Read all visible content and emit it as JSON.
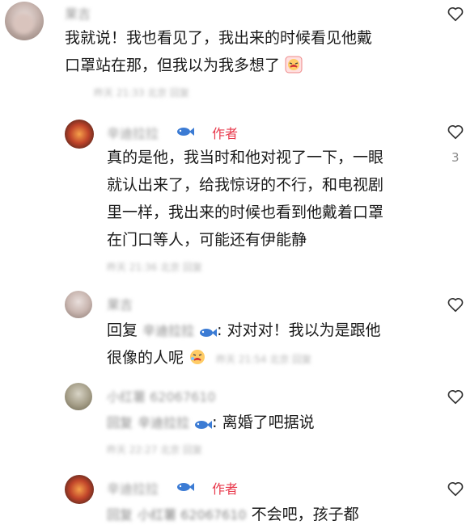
{
  "comments": [
    {
      "name": "果吉",
      "text_lines": [
        "我就说！我也看见了，我出来的时候看见他戴",
        "口罩站在那，但我以为我多想了"
      ],
      "meta": "昨天 21:33 北京 回复"
    },
    {
      "name": "辛迪拉拉",
      "author_tag": "作者",
      "text_lines": [
        "真的是他，我当时和他对视了一下，一眼",
        "就认出来了，给我惊讶的不行，和电视剧",
        "里一样，我出来的时候也看到他戴着口罩",
        "在门口等人，可能还有伊能静"
      ],
      "meta": "昨天 21:36 北京 回复",
      "like_count": "3"
    },
    {
      "name": "果吉",
      "reply_prefix": "回复",
      "reply_target": "辛迪拉拉",
      "text_part1": ": 对对对！我以为是跟他",
      "text_part2": "很像的人呢",
      "meta": "昨天 21:54 北京 回复"
    },
    {
      "name": "小红薯",
      "name_suffix": "62067610",
      "reply_prefix": "回复",
      "reply_target": "辛迪拉拉",
      "text": ": 离婚了吧据说",
      "meta": "昨天 22:27 北京 回复"
    },
    {
      "name": "辛迪拉拉",
      "author_tag": "作者",
      "reply_prefix": "回复",
      "reply_target": "小红薯 62067610",
      "text": "不会吧，孩子都"
    }
  ],
  "colors": {
    "author_red": "#e8384b",
    "name_gray": "#9a9a9a",
    "fish_blue": "#3b7bd4"
  },
  "icons": [
    "heart-outline-icon",
    "fish-badge-icon",
    "crying-emoji-icon"
  ]
}
